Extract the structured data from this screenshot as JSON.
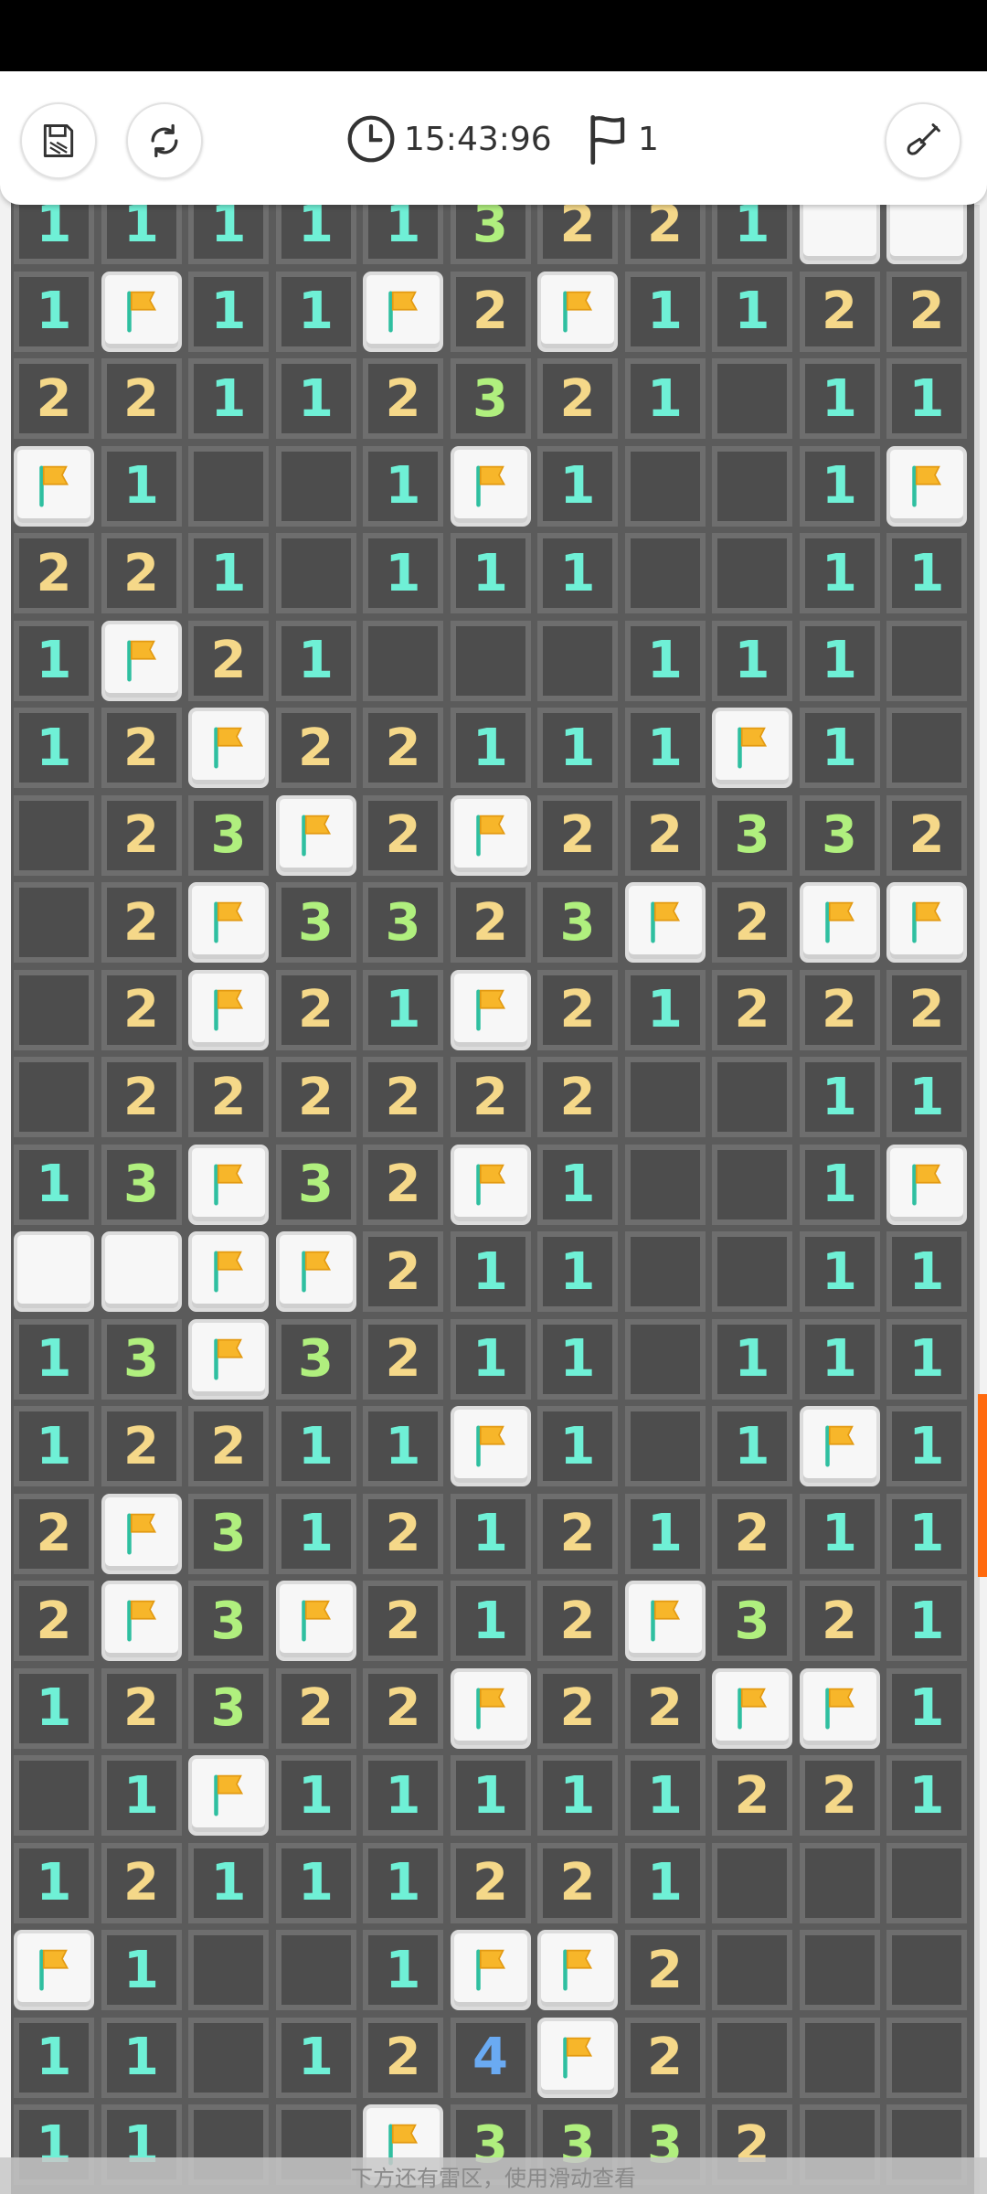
{
  "toolbar": {
    "save_icon": "save-disk-icon",
    "restart_icon": "refresh-icon",
    "timer_icon": "clock-icon",
    "timer_value": "15:43:96",
    "flag_icon": "flag-outline-icon",
    "flag_count": "1",
    "tool_icon": "shovel-icon"
  },
  "hint": "下方还有雷区，使用滑动查看",
  "colors": {
    "n1": "#6ff0d6",
    "n2": "#f5d889",
    "n3": "#b0ef7e",
    "n4": "#6aaaf2",
    "flag": "#f7b62a",
    "accent": "#ff6a0e"
  },
  "board": {
    "rows": [
      [
        "1",
        "1",
        "1",
        "1",
        "1",
        "3",
        "2",
        "2",
        "1",
        "C",
        "C"
      ],
      [
        "1",
        "F",
        "1",
        "1",
        "F",
        "2",
        "F",
        "1",
        "1",
        "2",
        "2"
      ],
      [
        "2",
        "2",
        "1",
        "1",
        "2",
        "3",
        "2",
        "1",
        "0",
        "1",
        "1"
      ],
      [
        "F",
        "1",
        "0",
        "0",
        "1",
        "F",
        "1",
        "0",
        "0",
        "1",
        "F"
      ],
      [
        "2",
        "2",
        "1",
        "0",
        "1",
        "1",
        "1",
        "0",
        "0",
        "1",
        "1"
      ],
      [
        "1",
        "F",
        "2",
        "1",
        "0",
        "0",
        "0",
        "1",
        "1",
        "1",
        "0"
      ],
      [
        "1",
        "2",
        "F",
        "2",
        "2",
        "1",
        "1",
        "1",
        "F",
        "1",
        "0"
      ],
      [
        "0",
        "2",
        "3",
        "F",
        "2",
        "F",
        "2",
        "2",
        "3",
        "3",
        "2"
      ],
      [
        "0",
        "2",
        "F",
        "3",
        "3",
        "2",
        "3",
        "F",
        "2",
        "F",
        "F"
      ],
      [
        "0",
        "2",
        "F",
        "2",
        "1",
        "F",
        "2",
        "1",
        "2",
        "2",
        "2"
      ],
      [
        "0",
        "2",
        "2",
        "2",
        "2",
        "2",
        "2",
        "0",
        "0",
        "1",
        "1"
      ],
      [
        "1",
        "3",
        "F",
        "3",
        "2",
        "F",
        "1",
        "0",
        "0",
        "1",
        "F"
      ],
      [
        "C",
        "C",
        "F",
        "F",
        "2",
        "1",
        "1",
        "0",
        "0",
        "1",
        "1"
      ],
      [
        "1",
        "3",
        "F",
        "3",
        "2",
        "1",
        "1",
        "0",
        "1",
        "1",
        "1"
      ],
      [
        "1",
        "2",
        "2",
        "1",
        "1",
        "F",
        "1",
        "0",
        "1",
        "F",
        "1"
      ],
      [
        "2",
        "F",
        "3",
        "1",
        "2",
        "1",
        "2",
        "1",
        "2",
        "1",
        "1"
      ],
      [
        "2",
        "F",
        "3",
        "F",
        "2",
        "1",
        "2",
        "F",
        "3",
        "2",
        "1"
      ],
      [
        "1",
        "2",
        "3",
        "2",
        "2",
        "F",
        "2",
        "2",
        "F",
        "F",
        "1"
      ],
      [
        "0",
        "1",
        "F",
        "1",
        "1",
        "1",
        "1",
        "1",
        "2",
        "2",
        "1"
      ],
      [
        "1",
        "2",
        "1",
        "1",
        "1",
        "2",
        "2",
        "1",
        "0",
        "0",
        "0"
      ],
      [
        "F",
        "1",
        "0",
        "0",
        "1",
        "F",
        "F",
        "2",
        "0",
        "0",
        "0"
      ],
      [
        "1",
        "1",
        "0",
        "1",
        "2",
        "4",
        "F",
        "2",
        "0",
        "0",
        "0"
      ],
      [
        "1",
        "1",
        "0",
        "0",
        "F",
        "3",
        "3",
        "3",
        "2",
        "0",
        "0"
      ]
    ]
  }
}
